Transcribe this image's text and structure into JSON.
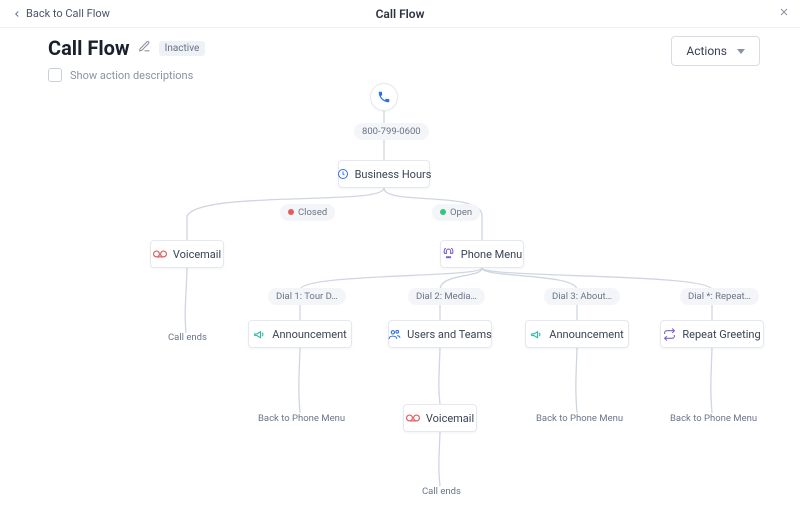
{
  "header": {
    "back_label": "Back to Call Flow",
    "title_center": "Call Flow",
    "page_title": "Call Flow",
    "status_badge": "Inactive",
    "show_descriptions_label": "Show action descriptions",
    "actions_button": "Actions"
  },
  "flow": {
    "phone_number": "800-799-0600",
    "business_hours": "Business Hours",
    "branch_closed": "Closed",
    "branch_open": "Open",
    "voicemail": "Voicemail",
    "phone_menu": "Phone Menu",
    "dial": {
      "d1": "Dial 1: Tour D…",
      "d2": "Dial 2: Media…",
      "d3": "Dial 3: About…",
      "dstar": "Dial *: Repeat…"
    },
    "announcement": "Announcement",
    "users_teams": "Users and Teams",
    "repeat_greeting": "Repeat Greeting",
    "voicemail2": "Voicemail",
    "call_ends": "Call ends",
    "back_to_menu": "Back to Phone Menu"
  }
}
